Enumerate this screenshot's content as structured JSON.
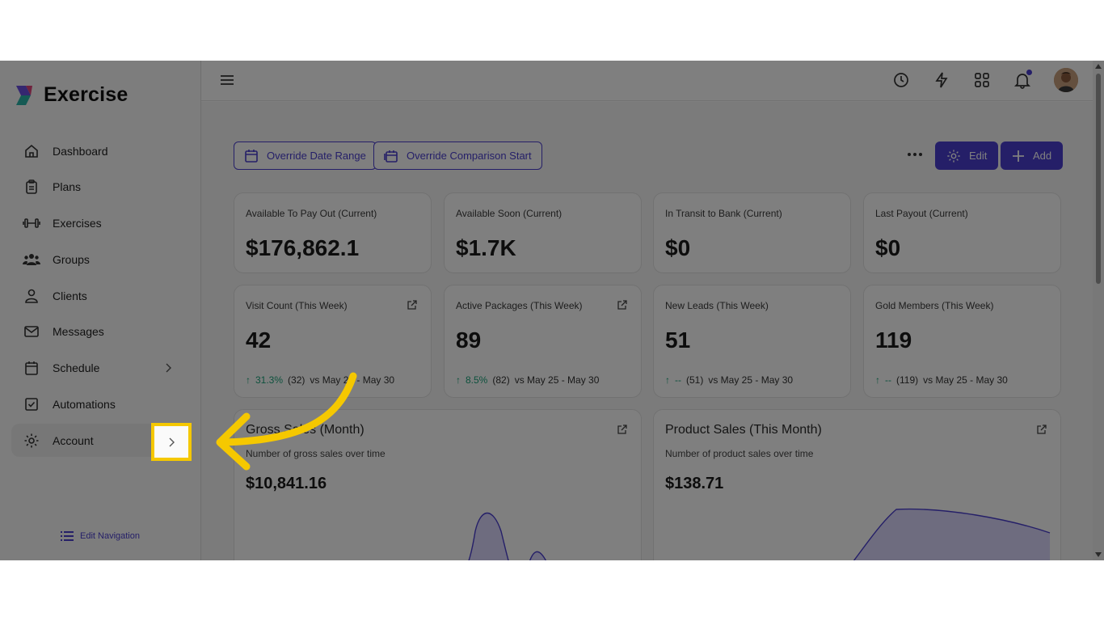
{
  "app": {
    "name": "Exercise"
  },
  "sidebar": {
    "items": [
      {
        "label": "Dashboard",
        "icon": "home-icon"
      },
      {
        "label": "Plans",
        "icon": "clipboard-icon"
      },
      {
        "label": "Exercises",
        "icon": "dumbbell-icon"
      },
      {
        "label": "Groups",
        "icon": "users-icon"
      },
      {
        "label": "Clients",
        "icon": "user-icon"
      },
      {
        "label": "Messages",
        "icon": "mail-icon"
      },
      {
        "label": "Schedule",
        "icon": "calendar-icon"
      },
      {
        "label": "Automations",
        "icon": "checkbox-icon"
      },
      {
        "label": "Account",
        "icon": "gear-icon"
      }
    ],
    "edit_navigation": "Edit Navigation"
  },
  "toolbar": {
    "override_date_range": "Override Date Range",
    "override_comparison_start": "Override Comparison Start",
    "edit": "Edit",
    "add": "Add"
  },
  "stats": [
    {
      "label": "Available To Pay Out (Current)",
      "value": "$176,862.1"
    },
    {
      "label": "Available Soon (Current)",
      "value": "$1.7K"
    },
    {
      "label": "In Transit to Bank (Current)",
      "value": "$0"
    },
    {
      "label": "Last Payout (Current)",
      "value": "$0"
    }
  ],
  "weekly": [
    {
      "label": "Visit Count (This Week)",
      "value": "42",
      "pct": "31.3%",
      "prev": "(32)",
      "range": "vs May 25 - May 30"
    },
    {
      "label": "Active Packages (This Week)",
      "value": "89",
      "pct": "8.5%",
      "prev": "(82)",
      "range": "vs May 25 - May 30"
    },
    {
      "label": "New Leads (This Week)",
      "value": "51",
      "pct": "--",
      "prev": "(51)",
      "range": "vs May 25 - May 30"
    },
    {
      "label": "Gold Members (This Week)",
      "value": "119",
      "pct": "--",
      "prev": "(119)",
      "range": "vs May 25 - May 30"
    }
  ],
  "charts": [
    {
      "title": "Gross Sales (Month)",
      "subtitle": "Number of gross sales over time",
      "value": "$10,841.16"
    },
    {
      "title": "Product Sales (This Month)",
      "subtitle": "Number of product sales over time",
      "value": "$138.71"
    }
  ],
  "colors": {
    "accent": "#4a3fd0",
    "highlight": "#f5c800",
    "trend_up": "#1aa37a"
  }
}
